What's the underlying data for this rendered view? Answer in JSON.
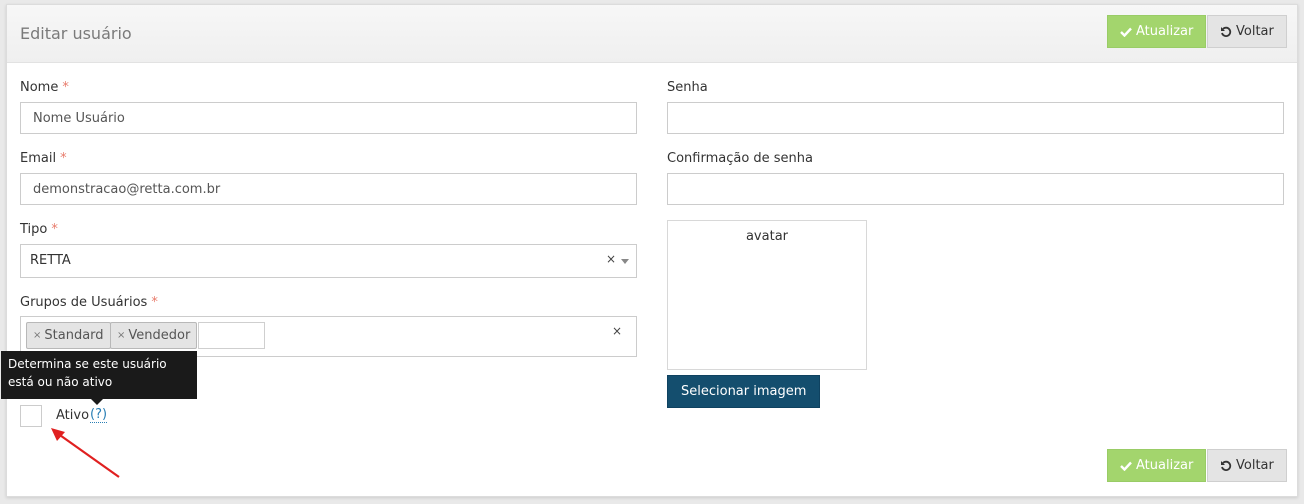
{
  "header": {
    "title": "Editar usuário",
    "update_label": "Atualizar",
    "back_label": "Voltar"
  },
  "form": {
    "name": {
      "label": "Nome",
      "required": "*",
      "value": "Nome Usuário"
    },
    "email": {
      "label": "Email",
      "required": "*",
      "value": "demonstracao@retta.com.br"
    },
    "type": {
      "label": "Tipo",
      "required": "*",
      "value": "RETTA",
      "clear": "×"
    },
    "groups": {
      "label": "Grupos de Usuários",
      "required": "*",
      "tags": [
        "Standard",
        "Vendedor"
      ],
      "tag_remove": "×",
      "clear": "×"
    },
    "password": {
      "label": "Senha",
      "value": ""
    },
    "password_confirm": {
      "label": "Confirmação de senha",
      "value": ""
    },
    "avatar": {
      "label": "avatar",
      "select_label": "Selecionar imagem"
    },
    "active": {
      "label": "Ativo",
      "help": "(?)",
      "tooltip": "Determina se este usuário está ou não ativo",
      "checked": false
    }
  },
  "footer": {
    "update_label": "Atualizar",
    "back_label": "Voltar"
  },
  "colors": {
    "success": "#a3d56d",
    "primary": "#144e6e",
    "required": "#e87b6b",
    "annotation_arrow": "#e02020"
  },
  "icons": {
    "update": "check-icon",
    "back": "undo-icon"
  }
}
